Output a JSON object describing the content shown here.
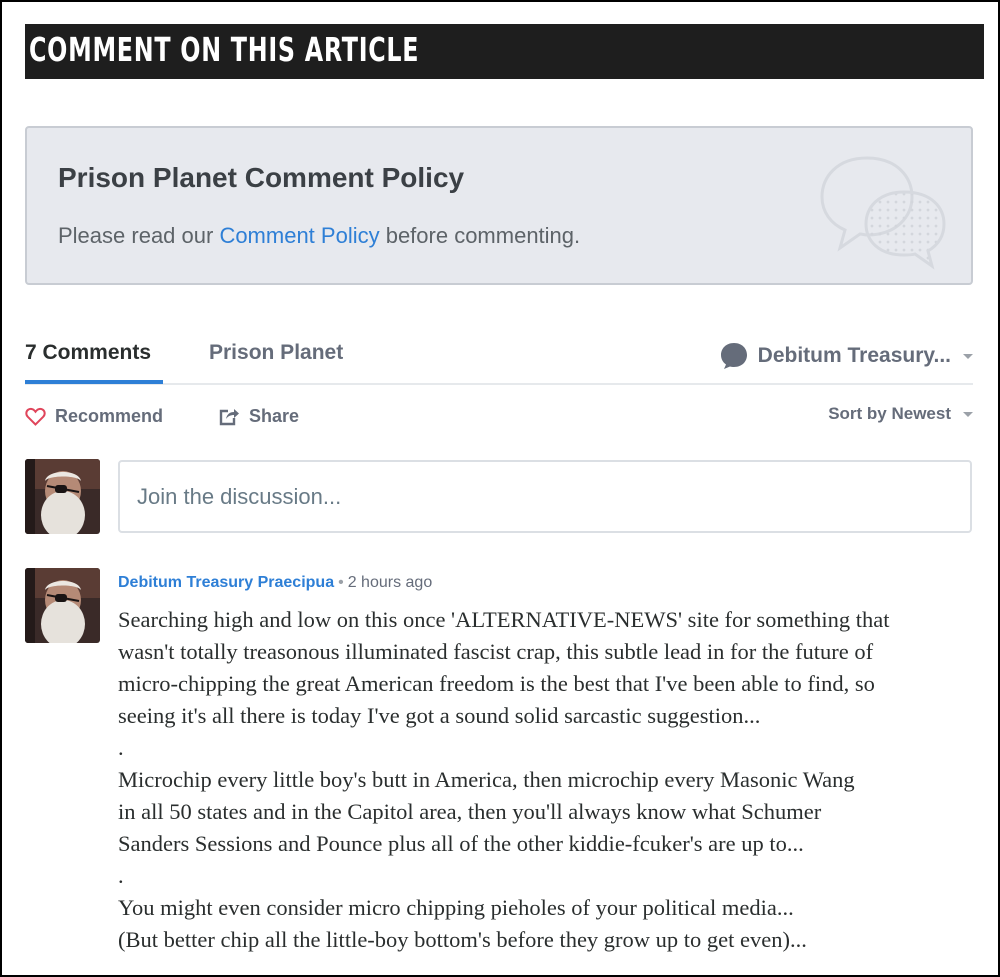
{
  "header": {
    "title": "COMMENT ON THIS ARTICLE"
  },
  "policy": {
    "title": "Prison Planet Comment Policy",
    "text_before": "Please read our ",
    "link_label": "Comment Policy",
    "text_after": " before commenting."
  },
  "tabs": {
    "comments_label": "7 Comments",
    "site_label": "Prison Planet",
    "user_label": "Debitum Treasury..."
  },
  "actions": {
    "recommend_label": "Recommend",
    "share_label": "Share",
    "sort_label": "Sort by Newest"
  },
  "composer": {
    "placeholder": "Join the discussion..."
  },
  "comment": {
    "author": "Debitum Treasury Praecipua",
    "separator": "•",
    "time": "2 hours ago",
    "lines": [
      "Searching high and low on this once 'ALTERNATIVE-NEWS' site for something that",
      "wasn't totally treasonous illuminated fascist crap, this subtle lead in for the future of",
      "micro-chipping the great American freedom is the best that I've been able to find, so",
      "seeing it's all there is today I've got a sound solid sarcastic suggestion...",
      ".",
      "Microchip every little boy's butt in America, then microchip every Masonic Wang",
      "in all 50 states and in the Capitol area, then you'll always know what Schumer",
      "Sanders Sessions and Pounce plus all of the other kiddie-fcuker's are up to...",
      ".",
      "You might even consider micro chipping pieholes of your political media...",
      "(But better chip all the little-boy bottom's before they grow up to get even)...",
      "."
    ]
  },
  "colors": {
    "accent": "#2e7fd6",
    "header_bg": "#1e1e1e",
    "policy_bg": "#e7e9ee",
    "muted": "#656c7a"
  },
  "icons": [
    "speech-bubbles-icon",
    "user-bubble-icon",
    "caret-down-icon",
    "heart-icon",
    "share-icon"
  ]
}
